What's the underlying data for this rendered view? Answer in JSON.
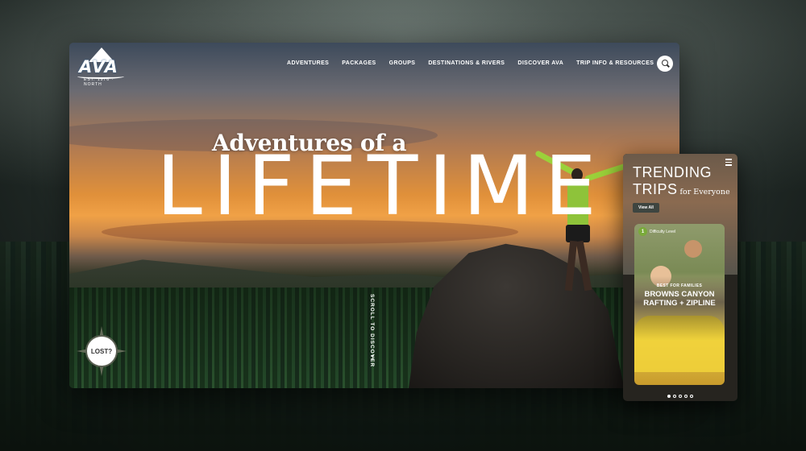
{
  "brand": {
    "logo_text": "AVA",
    "logo_tagline": "EST. 1976  ·  NORTH"
  },
  "nav": {
    "items": [
      {
        "label": "ADVENTURES"
      },
      {
        "label": "PACKAGES"
      },
      {
        "label": "GROUPS"
      },
      {
        "label": "DESTINATIONS & RIVERS"
      },
      {
        "label": "DISCOVER AVA"
      },
      {
        "label": "TRIP INFO & RESOURCES"
      }
    ],
    "search_icon": "search-icon"
  },
  "hero": {
    "tagline": "Adventures of a",
    "headline": "LIFETIME",
    "scroll_hint": "SCROLL TO DISCOVER"
  },
  "lost_badge": {
    "label": "LOST?"
  },
  "mobile": {
    "heading_line1": "TRENDING",
    "heading_line2": "TRIPS",
    "heading_sub": "for Everyone",
    "view_all": "View All",
    "card": {
      "difficulty_number": "1",
      "difficulty_label": "Difficulty Level",
      "category": "BEST FOR FAMILIES",
      "title": "BROWNS CANYON RAFTING + ZIPLINE"
    },
    "pagination": {
      "count": 5,
      "active_index": 0
    }
  },
  "colors": {
    "accent_green": "#8ec33a",
    "nav_text": "#ffffff"
  }
}
